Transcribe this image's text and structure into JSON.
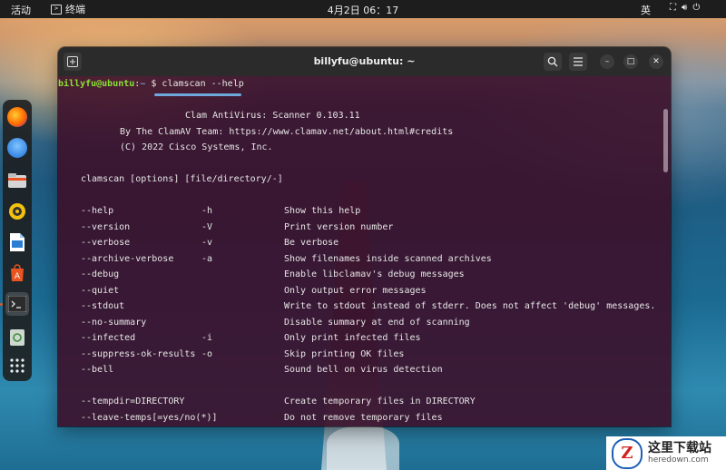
{
  "topbar": {
    "activities": "活动",
    "app_name": "终端",
    "app_icon": "terminal-icon",
    "clock": "4月2日  06：17",
    "ime": "英",
    "tray_icons": [
      "network-icon",
      "volume-icon",
      "power-icon"
    ]
  },
  "dock": {
    "items": [
      {
        "name": "firefox-icon"
      },
      {
        "name": "thunderbird-icon"
      },
      {
        "name": "files-icon"
      },
      {
        "name": "rhythmbox-icon"
      },
      {
        "name": "writer-icon"
      },
      {
        "name": "app-center-icon"
      },
      {
        "name": "terminal-icon",
        "active": true
      },
      {
        "name": "trash-icon"
      },
      {
        "name": "show-apps-icon"
      }
    ]
  },
  "terminal": {
    "title": "billyfu@ubuntu: ~",
    "prompt_user": "billyfu@ubuntu",
    "prompt_path": "~",
    "prompt_symbol": "$",
    "command": "clamscan --help",
    "banner": [
      "Clam AntiVirus: Scanner 0.103.11",
      "By The ClamAV Team: https://www.clamav.net/about.html#credits",
      "(C) 2022 Cisco Systems, Inc."
    ],
    "usage": "clamscan [options] [file/directory/-]",
    "options": [
      {
        "long": "--help",
        "short": "-h",
        "desc": "Show this help"
      },
      {
        "long": "--version",
        "short": "-V",
        "desc": "Print version number"
      },
      {
        "long": "--verbose",
        "short": "-v",
        "desc": "Be verbose"
      },
      {
        "long": "--archive-verbose",
        "short": "-a",
        "desc": "Show filenames inside scanned archives"
      },
      {
        "long": "--debug",
        "short": "",
        "desc": "Enable libclamav's debug messages"
      },
      {
        "long": "--quiet",
        "short": "",
        "desc": "Only output error messages"
      },
      {
        "long": "--stdout",
        "short": "",
        "desc": "Write to stdout instead of stderr. Does not affect 'debug' messages."
      },
      {
        "long": "--no-summary",
        "short": "",
        "desc": "Disable summary at end of scanning"
      },
      {
        "long": "--infected",
        "short": "-i",
        "desc": "Only print infected files"
      },
      {
        "long": "--suppress-ok-results",
        "short": "-o",
        "desc": "Skip printing OK files"
      },
      {
        "long": "--bell",
        "short": "",
        "desc": "Sound bell on virus detection"
      }
    ],
    "options2": [
      {
        "long": "--tempdir=DIRECTORY",
        "short": "",
        "desc": "Create temporary files in DIRECTORY"
      },
      {
        "long": "--leave-temps[=yes/no(*)]",
        "short": "",
        "desc": "Do not remove temporary files"
      }
    ]
  },
  "watermark": {
    "logo_letter": "Z",
    "cn": "这里下载站",
    "en": "heredown.com"
  },
  "colors": {
    "terminal_bg": "#3c102a",
    "prompt_user": "#8ae234",
    "prompt_path": "#729fcf",
    "underline": "#6fa8dc"
  }
}
